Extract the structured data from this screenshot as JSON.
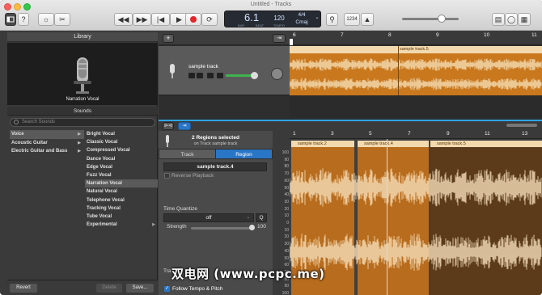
{
  "window": {
    "title": "Untitled - Tracks"
  },
  "lcd": {
    "bar": "6",
    "beat": "1",
    "bar_label": "BAR",
    "beat_label": "BEAT",
    "tempo": "120",
    "tempo_label": "TEMPO",
    "signature": "4/4",
    "key": "Cmaj"
  },
  "toolbar": {
    "count_in": "1234"
  },
  "library": {
    "title": "Library",
    "patch_name": "Narration Vocal",
    "sounds_label": "Sounds",
    "search_placeholder": "Search Sounds",
    "categories": [
      "Voice",
      "Acoustic Guitar",
      "Electric Guitar and Bass"
    ],
    "items": [
      "Bright Vocal",
      "Classic Vocal",
      "Compressed Vocal",
      "Dance Vocal",
      "Edge Vocal",
      "Fuzz Vocal",
      "Narration Vocal",
      "Natural Vocal",
      "Telephone Vocal",
      "Tracking Vocal",
      "Tube Vocal",
      "Experimental"
    ],
    "revert_label": "Revert",
    "delete_label": "Delete",
    "save_label": "Save..."
  },
  "tracks": {
    "ruler": [
      "6",
      "7",
      "8",
      "9",
      "10",
      "11"
    ],
    "track_name": "sample track",
    "region_name": "sample track.5"
  },
  "editor": {
    "regions_selected": "2 Regions selected",
    "on_track": "on Track sample track",
    "tab_track": "Track",
    "tab_region": "Region",
    "region_field": "sample track.4",
    "reverse_playback": "Reverse Playback",
    "time_quantize": "Time Quantize",
    "quantize_value": "off",
    "strength_label": "Strength",
    "strength_value": "100",
    "transpose_label": "Tra",
    "follow_tempo": "Follow Tempo & Pitch",
    "ruler": [
      "1",
      "3",
      "5",
      "7",
      "9",
      "11",
      "13"
    ],
    "db_scale": [
      "100",
      "90",
      "80",
      "70",
      "60",
      "50",
      "40",
      "30",
      "20",
      "10",
      "0",
      "10",
      "20",
      "30",
      "40",
      "50",
      "60",
      "70",
      "80",
      "90",
      "100"
    ],
    "regions": [
      "sample track.2",
      "sample track.4",
      "sample track.5"
    ]
  },
  "watermark": "双电网 (www.pcpc.me)"
}
